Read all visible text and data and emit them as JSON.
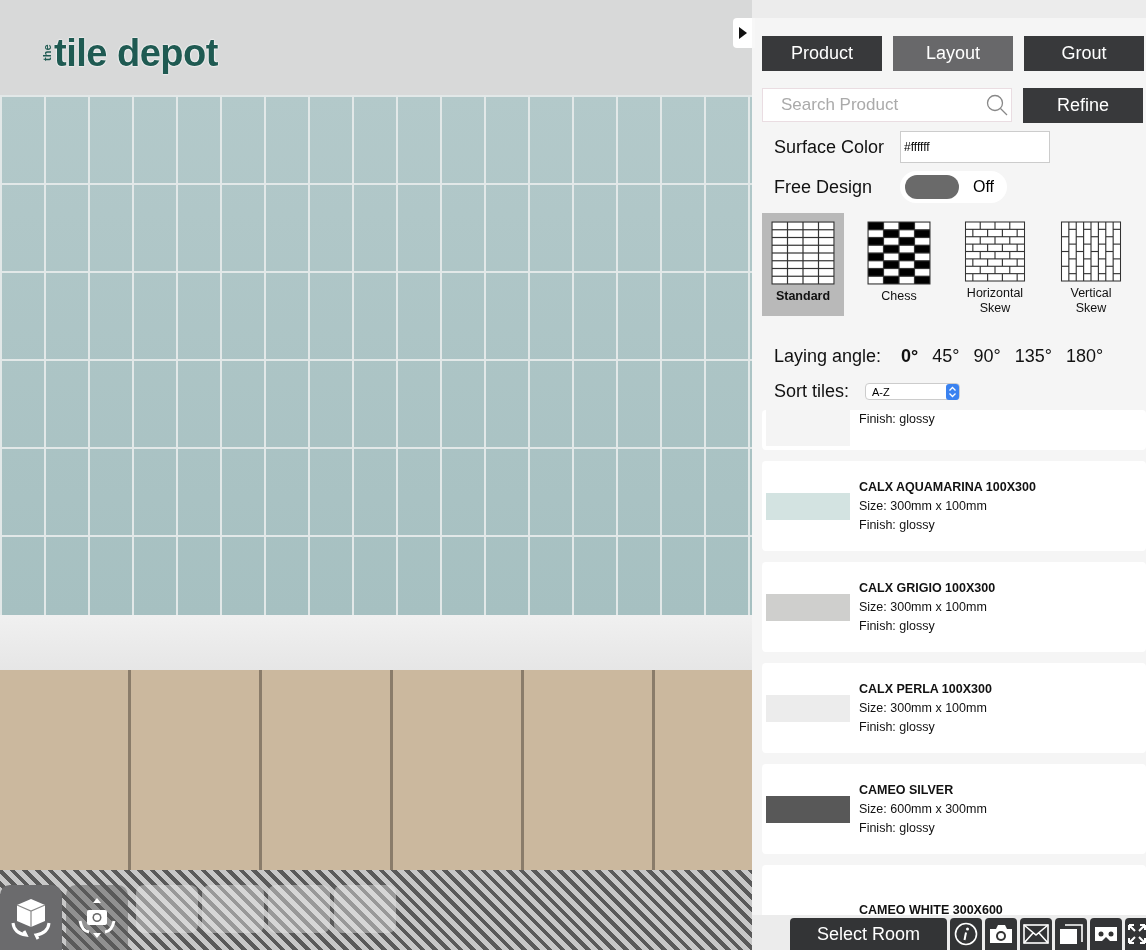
{
  "logo": {
    "small": "the",
    "main": "tile depot"
  },
  "tabs": [
    {
      "label": "Product",
      "selected": false
    },
    {
      "label": "Layout",
      "selected": true
    },
    {
      "label": "Grout",
      "selected": false
    }
  ],
  "search": {
    "placeholder": "Search Product"
  },
  "refine_button": "Refine",
  "surface_color": {
    "label": "Surface Color",
    "value": "#ffffff"
  },
  "free_design": {
    "label": "Free Design",
    "on": false,
    "state_label": "Off"
  },
  "patterns": [
    {
      "kind": "standard",
      "label": "Standard",
      "selected": true
    },
    {
      "kind": "chess",
      "label": "Chess",
      "selected": false
    },
    {
      "kind": "horizontal_skew",
      "label": "Horizontal Skew",
      "selected": false
    },
    {
      "kind": "vertical_skew",
      "label": "Vertical Skew",
      "selected": false
    }
  ],
  "laying_angle": {
    "label": "Laying angle:",
    "options": [
      {
        "label": "0°",
        "selected": true
      },
      {
        "label": "45°",
        "selected": false
      },
      {
        "label": "90°",
        "selected": false
      },
      {
        "label": "135°",
        "selected": false
      },
      {
        "label": "180°",
        "selected": false
      }
    ]
  },
  "sort": {
    "label": "Sort tiles:",
    "value": "A-Z"
  },
  "products": [
    {
      "finish": "Finish: glossy",
      "color": "#f4f4f4"
    },
    {
      "name": "CALX AQUAMARINA 100X300",
      "size": "Size: 300mm x 100mm",
      "finish": "Finish: glossy",
      "color": "#d3e3e1"
    },
    {
      "name": "CALX GRIGIO 100X300",
      "size": "Size: 300mm x 100mm",
      "finish": "Finish: glossy",
      "color": "#cfcfcd"
    },
    {
      "name": "CALX PERLA 100X300",
      "size": "Size: 300mm x 100mm",
      "finish": "Finish: glossy",
      "color": "#ececec"
    },
    {
      "name": "CAMEO SILVER",
      "size": "Size: 600mm x 300mm",
      "finish": "Finish: glossy",
      "color": "#585858"
    },
    {
      "name": "CAMEO WHITE 300X600"
    }
  ],
  "select_room_button": "Select Room"
}
